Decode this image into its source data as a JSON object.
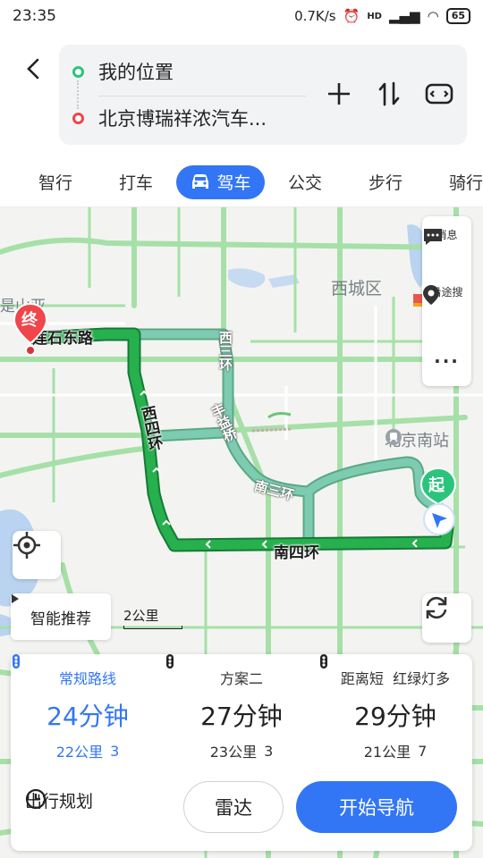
{
  "status": {
    "time": "23:35",
    "speed": "0.7K/s",
    "network": "HD",
    "battery": "65"
  },
  "route": {
    "from": "我的位置",
    "to": "北京博瑞祥浓汽车..."
  },
  "tabs": [
    {
      "label": "智行"
    },
    {
      "label": "打车"
    },
    {
      "label": "驾车",
      "active": true
    },
    {
      "label": "公交"
    },
    {
      "label": "步行"
    },
    {
      "label": "骑行"
    }
  ],
  "map": {
    "district": "西城区",
    "poi": "北京南站",
    "partial_label": "是山亚",
    "roads": [
      "莲石东路",
      "西四环",
      "南四环",
      "西三环",
      "南三环",
      "丰益桥"
    ],
    "end_pin": "终",
    "start_pin": "起",
    "side_panel": {
      "message": "消息",
      "along_route": "沿途搜",
      "more": "···"
    },
    "smart_recommend": "智能推荐",
    "scale": "2公里"
  },
  "plans": [
    {
      "name": "常规路线",
      "time": "24分钟",
      "distance": "22公里",
      "lights": "3",
      "active": true
    },
    {
      "name": "方案二",
      "time": "27分钟",
      "distance": "23公里",
      "lights": "3"
    },
    {
      "name": "距离短  红绿灯多",
      "time": "29分钟",
      "distance": "21公里",
      "lights": "7"
    }
  ],
  "actions": {
    "trip_plan": "出行规划",
    "radar": "雷达",
    "start_nav": "开始导航"
  },
  "colors": {
    "accent": "#3276f5",
    "route_primary": "#1fa84a",
    "route_alt": "#74c7ab",
    "start_green": "#2bc47d",
    "end_red": "#f0454b"
  }
}
